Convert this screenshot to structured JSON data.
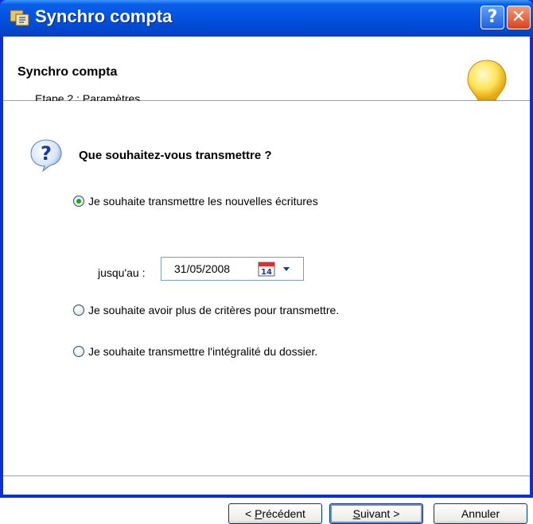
{
  "window": {
    "title": "Synchro compta",
    "help_label": "?",
    "close_label": "✕"
  },
  "header": {
    "title": "Synchro compta",
    "subtitle": "Etape 2 : Paramètres"
  },
  "content": {
    "question": "Que souhaitez-vous transmettre ?",
    "options": [
      {
        "label": "Je souhaite transmettre les nouvelles écritures",
        "checked": true
      },
      {
        "label": "Je souhaite avoir plus de critères pour transmettre.",
        "checked": false
      },
      {
        "label": "Je souhaite transmettre l'intégralité du dossier.",
        "checked": false
      }
    ],
    "until_label": "jusqu'au :",
    "date_value": "31/05/2008",
    "calendar_day": "14"
  },
  "buttons": {
    "previous_prefix": "< ",
    "previous_mnemonic": "P",
    "previous_rest": "récédent",
    "next_mnemonic": "S",
    "next_rest": "uivant >",
    "cancel": "Annuler"
  },
  "icons": {
    "app": "app-sync-icon",
    "question": "question-help-icon",
    "lightbulb": "lightbulb-icon",
    "calendar": "calendar-icon",
    "dropdown": "dropdown-arrow-icon"
  },
  "colors": {
    "titlebar": "#0353e0",
    "radio_checked": "#21a121"
  }
}
